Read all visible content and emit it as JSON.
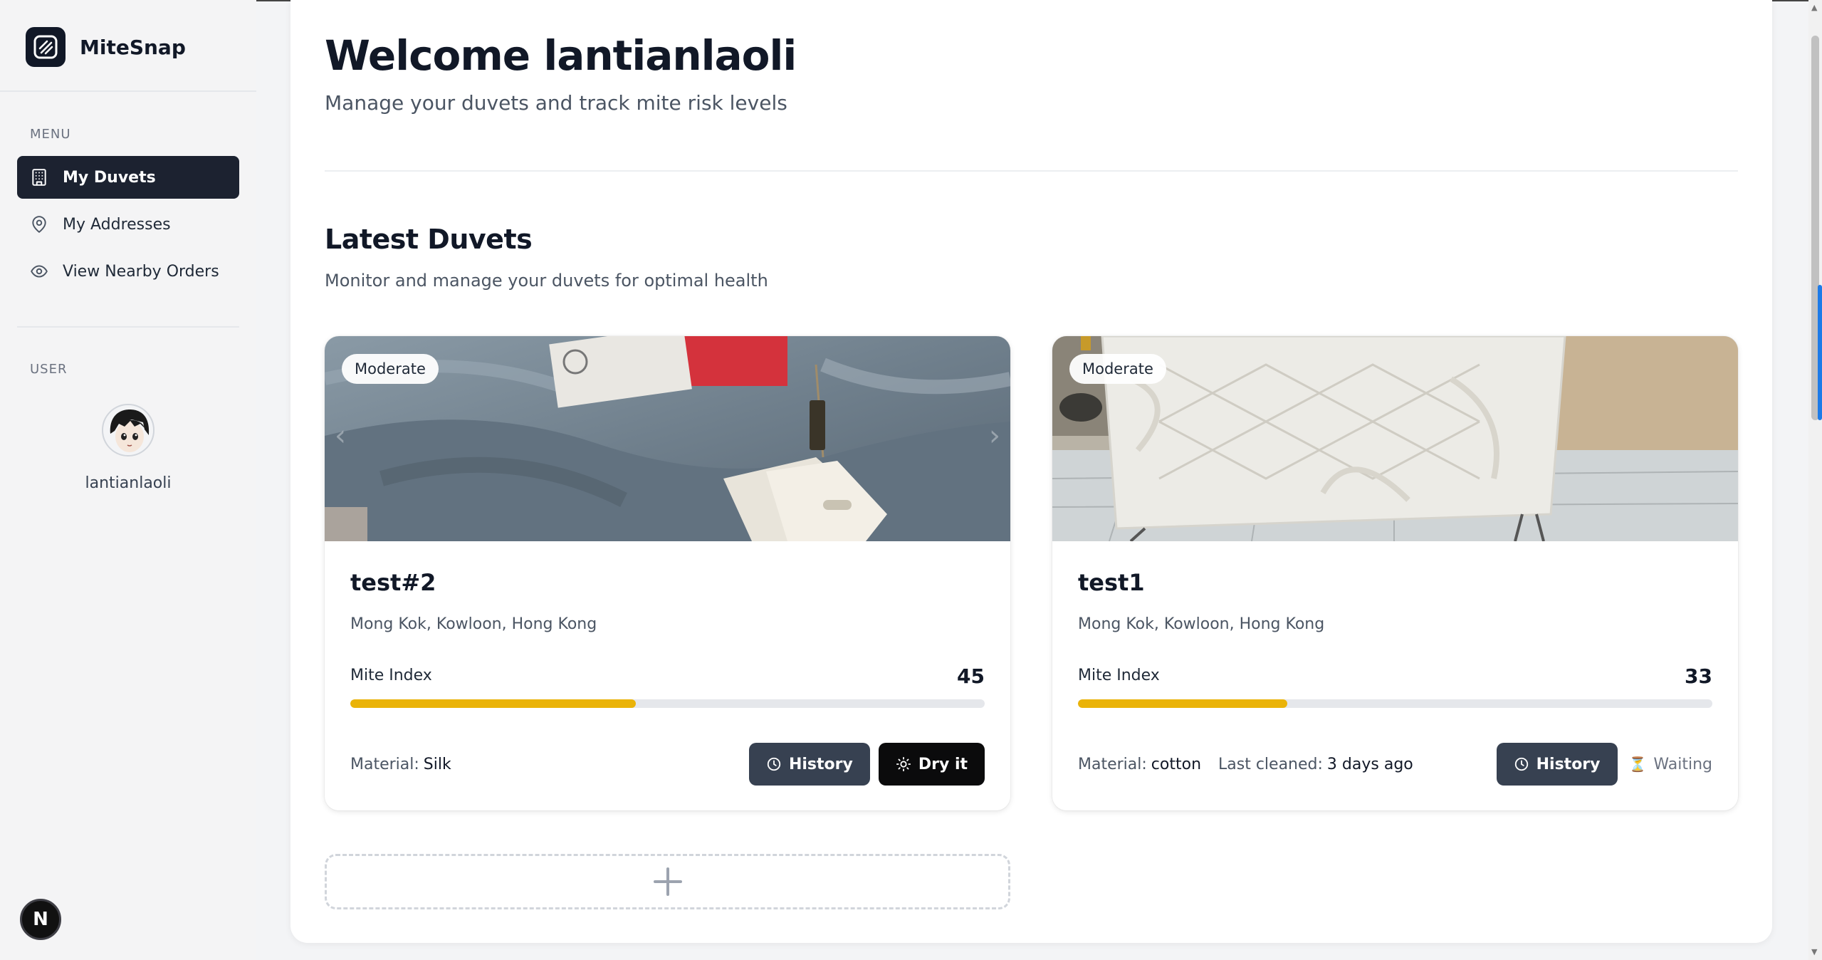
{
  "app": {
    "name": "MiteSnap"
  },
  "sidebar": {
    "menu_heading": "MENU",
    "items": [
      {
        "label": "My Duvets",
        "icon": "building-icon",
        "active": true
      },
      {
        "label": "My Addresses",
        "icon": "map-pin-icon",
        "active": false
      },
      {
        "label": "View Nearby Orders",
        "icon": "eye-icon",
        "active": false
      }
    ],
    "user_heading": "USER",
    "user": {
      "name": "lantianlaoli"
    },
    "dev_badge": "N"
  },
  "header": {
    "title": "Welcome lantianlaoli",
    "subtitle": "Manage your duvets and track mite risk levels"
  },
  "section": {
    "title": "Latest Duvets",
    "subtitle": "Monitor and manage your duvets for optimal health"
  },
  "duvets": [
    {
      "name": "test#2",
      "risk": "Moderate",
      "location": "Mong Kok, Kowloon, Hong Kong",
      "mite_label": "Mite Index",
      "mite_index": "45",
      "mite_fraction": 0.45,
      "material_label": "Material:",
      "material": "Silk",
      "history_label": "History",
      "action_label": "Dry it"
    },
    {
      "name": "test1",
      "risk": "Moderate",
      "location": "Mong Kok, Kowloon, Hong Kong",
      "mite_label": "Mite Index",
      "mite_index": "33",
      "mite_fraction": 0.33,
      "material_label": "Material:",
      "material": "cotton",
      "last_cleaned_label": "Last cleaned:",
      "last_cleaned": "3 days ago",
      "history_label": "History",
      "status_label": "Waiting"
    }
  ],
  "colors": {
    "sidebar_active": "#1c2230",
    "bar_fill": "#eab308",
    "history_button": "#374151",
    "dry_button": "#0b0b0c"
  }
}
